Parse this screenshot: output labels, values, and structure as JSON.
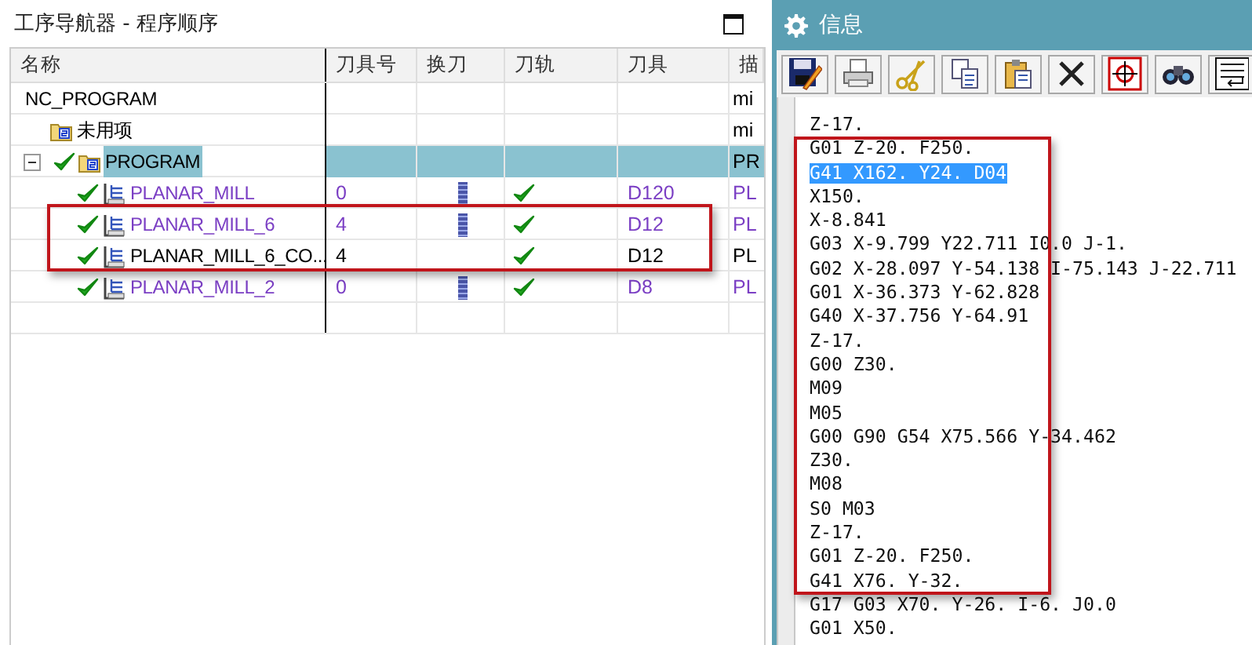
{
  "navigator": {
    "title": "工序导航器 - 程序顺序",
    "columns": [
      "名称",
      "刀具号",
      "换刀",
      "刀轨",
      "刀具",
      "描"
    ],
    "tree": [
      {
        "name": "NC_PROGRAM",
        "status_ok": false,
        "selected": false,
        "column_6": "mi",
        "children": [
          {
            "kind": "group",
            "name": "未用项",
            "status_ok": false,
            "selected": false,
            "column_6": "mi"
          },
          {
            "kind": "group",
            "name": "PROGRAM",
            "status_ok": true,
            "selected": true,
            "expanded": true,
            "column_6": "PR",
            "children": [
              {
                "kind": "operation",
                "name": "PLANAR_MILL",
                "color": "#7b3fc4",
                "status_ok": true,
                "selected": false,
                "tool_number": "0",
                "tool_change": true,
                "toolpath": true,
                "tool": "D120",
                "column_6": "PL"
              },
              {
                "kind": "operation",
                "name": "PLANAR_MILL_6",
                "color": "#7b3fc4",
                "status_ok": true,
                "selected": false,
                "tool_number": "4",
                "tool_change": true,
                "toolpath": true,
                "tool": "D12",
                "column_6": "PL"
              },
              {
                "kind": "operation",
                "name": "PLANAR_MILL_6_CO...",
                "color": "#000000",
                "status_ok": true,
                "selected": false,
                "tool_number": "4",
                "tool_change": false,
                "toolpath": true,
                "tool": "D12",
                "column_6": "PL"
              },
              {
                "kind": "operation",
                "name": "PLANAR_MILL_2",
                "color": "#7b3fc4",
                "status_ok": true,
                "selected": false,
                "tool_number": "0",
                "tool_change": true,
                "toolpath": true,
                "tool": "D8",
                "column_6": "PL"
              }
            ]
          }
        ]
      }
    ]
  },
  "info": {
    "title": "信息",
    "lines": [
      {
        "text": "Z-17.",
        "selected": false
      },
      {
        "text": "G01 Z-20. F250.",
        "selected": false
      },
      {
        "text": "G41 X162. Y24. D04",
        "selected": true
      },
      {
        "text": "X150.",
        "selected": false
      },
      {
        "text": "X-8.841",
        "selected": false
      },
      {
        "text": "G03 X-9.799 Y22.711 I0.0 J-1.",
        "selected": false
      },
      {
        "text": "G02 X-28.097 Y-54.138 I-75.143 J-22.711",
        "selected": false
      },
      {
        "text": "G01 X-36.373 Y-62.828",
        "selected": false
      },
      {
        "text": "G40 X-37.756 Y-64.91",
        "selected": false
      },
      {
        "text": "Z-17.",
        "selected": false
      },
      {
        "text": "G00 Z30.",
        "selected": false
      },
      {
        "text": "M09",
        "selected": false
      },
      {
        "text": "M05",
        "selected": false
      },
      {
        "text": "G00 G90 G54 X75.566 Y-34.462",
        "selected": false
      },
      {
        "text": "Z30.",
        "selected": false
      },
      {
        "text": "M08",
        "selected": false
      },
      {
        "text": "S0 M03",
        "selected": false
      },
      {
        "text": "Z-17.",
        "selected": false
      },
      {
        "text": "G01 Z-20. F250.",
        "selected": false
      },
      {
        "text": "G41 X76. Y-32.",
        "selected": false
      },
      {
        "text": "G17 G03 X70. Y-26. I-6. J0.0",
        "selected": false
      },
      {
        "text": "G01 X50.",
        "selected": false
      }
    ]
  }
}
